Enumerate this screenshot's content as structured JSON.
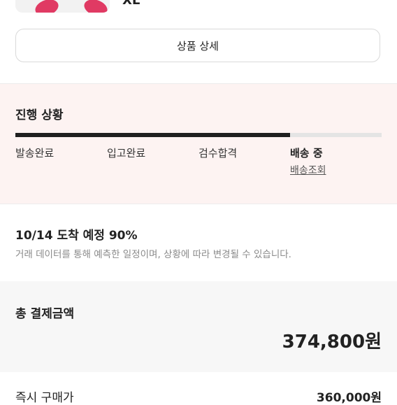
{
  "product": {
    "size": "XL"
  },
  "detail_button_label": "상품 상세",
  "progress": {
    "title": "진행 상황",
    "completion": 0.75,
    "steps": [
      {
        "label": "발송완료"
      },
      {
        "label": "입고완료"
      },
      {
        "label": "검수합격"
      },
      {
        "label": "배송 중"
      }
    ],
    "track_link": "배송조회"
  },
  "eta": {
    "title": "10/14 도착 예정 90%",
    "description": "거래 데이터를 통해 예측한 일정이며, 상황에 따라 변경될 수 있습니다."
  },
  "payment": {
    "title": "총 결제금액",
    "amount": "374,800원"
  },
  "price_row": {
    "label": "즉시 구매가",
    "amount": "360,000원"
  },
  "colors": {
    "progress_bg": "#fdf3f2",
    "track_fill": "#1f1f1f",
    "track_bg": "#e4e4e4",
    "pay_bg": "#f7f7f7"
  }
}
